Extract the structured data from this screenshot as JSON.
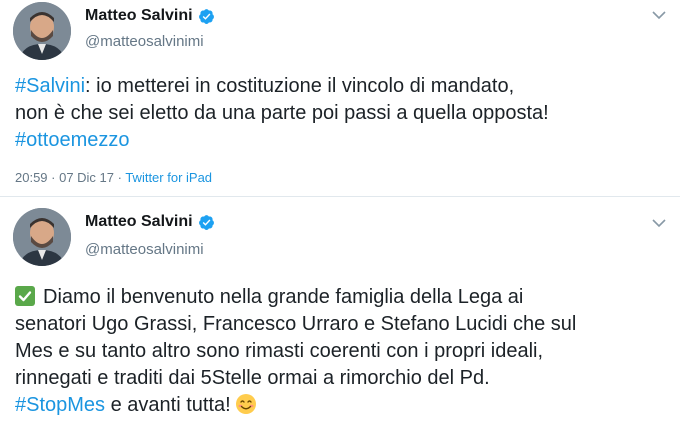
{
  "tweets": [
    {
      "author": {
        "name": "Matteo Salvini",
        "handle": "@matteosalvinimi"
      },
      "lines": {
        "l1_hashtag": "#Salvini",
        "l1_rest": ": io metterei in costituzione il vincolo di mandato,",
        "l2": "non è che sei eletto da una parte poi passi a quella opposta!",
        "l3_hashtag": "#ottoemezzo"
      },
      "meta": {
        "time": "20:59 · 07 Dic 17 · ",
        "source": "Twitter for iPad"
      }
    },
    {
      "author": {
        "name": "Matteo Salvini",
        "handle": "@matteosalvinimi"
      },
      "lines": {
        "l1": "Diamo il benvenuto nella grande famiglia della Lega ai",
        "l2": "senatori Ugo Grassi, Francesco Urraro e Stefano Lucidi che sul",
        "l3": "Mes e su tanto altro sono rimasti coerenti con i propri ideali,",
        "l4": "rinnegati e traditi dai 5Stelle ormai a rimorchio del Pd.",
        "l5_hashtag": "#StopMes",
        "l5_rest": " e avanti tutta!"
      },
      "icons": {
        "leading": "check-mark-button-icon",
        "trailing": "smiling-face-icon"
      }
    }
  ],
  "colors": {
    "hashtag": "#1b95e0",
    "verified": "#1da1f2",
    "secondary": "#657786",
    "check_green": "#5aa84a"
  }
}
